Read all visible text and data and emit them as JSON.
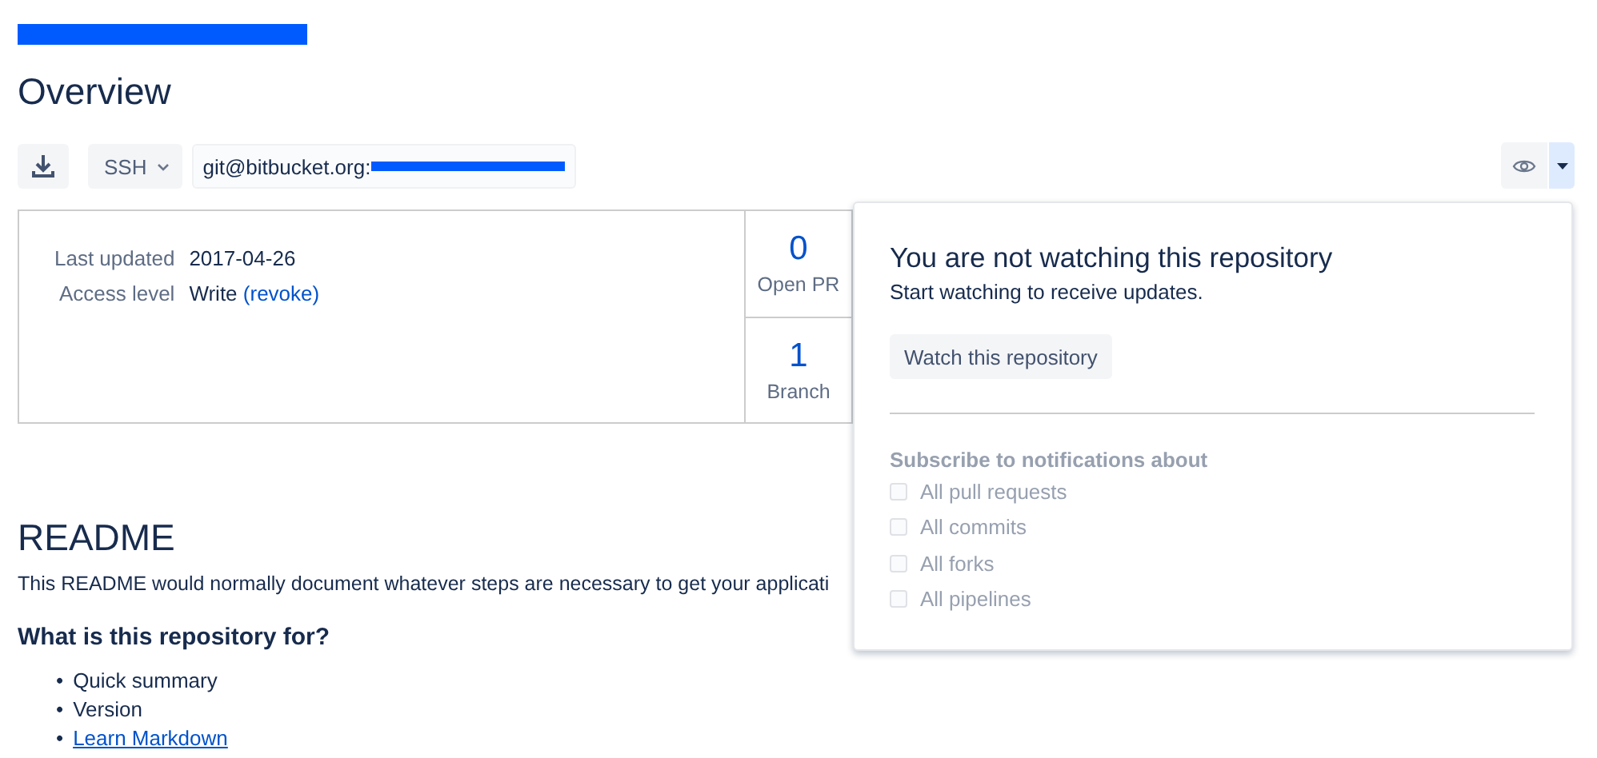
{
  "page": {
    "title": "Overview"
  },
  "clone_bar": {
    "protocol": "SSH",
    "url": "git@bitbucket.org:"
  },
  "summary": {
    "rows": [
      {
        "label": "Last updated",
        "value": "2017-04-26"
      },
      {
        "label": "Access level",
        "value": "Write",
        "link": "(revoke)"
      }
    ],
    "stats": [
      {
        "count": "0",
        "label": "Open PR"
      },
      {
        "count": "1",
        "label": "Branch"
      }
    ]
  },
  "watch": {
    "expanded": true
  },
  "watch_popover": {
    "title": "You are not watching this repository",
    "subtitle": "Start watching to receive updates.",
    "button": "Watch this repository",
    "subscribe_heading": "Subscribe to notifications about",
    "options": [
      {
        "label": "All pull requests",
        "checked": false,
        "disabled": true
      },
      {
        "label": "All commits",
        "checked": false,
        "disabled": true
      },
      {
        "label": "All forks",
        "checked": false,
        "disabled": true
      },
      {
        "label": "All pipelines",
        "checked": false,
        "disabled": true
      }
    ]
  },
  "readme": {
    "title": "README",
    "text": "This README would normally document whatever steps are necessary to get your applicati",
    "subheading": "What is this repository for?",
    "items": [
      {
        "marker": "•",
        "text": "Quick summary",
        "kind": "text"
      },
      {
        "marker": "•",
        "text": "Version",
        "kind": "text"
      },
      {
        "marker": "•",
        "text": "Learn Markdown",
        "kind": "link"
      }
    ]
  }
}
